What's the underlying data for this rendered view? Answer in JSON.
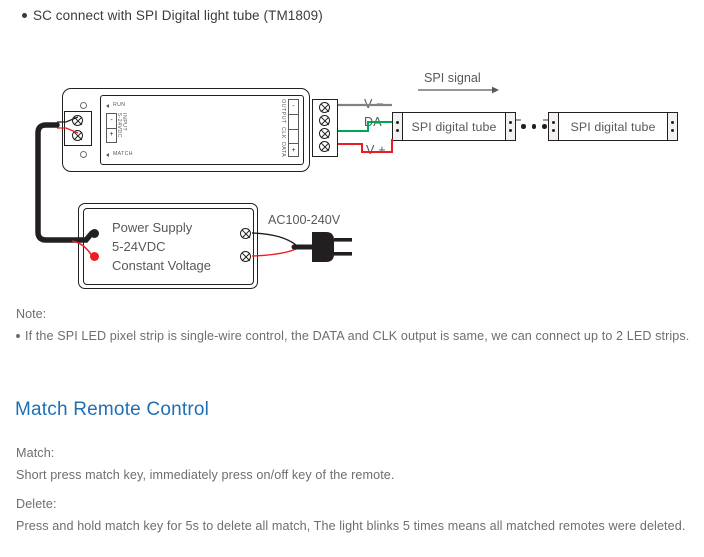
{
  "intro": {
    "bullet": "SC connect with SPI Digital light tube (TM1809)"
  },
  "diagram": {
    "signal_label": "SPI signal",
    "controller": {
      "run_label": "RUN",
      "match_label": "MATCH",
      "input_label": "INPUT",
      "input_voltage": "5-24VDC",
      "input_minus": "-",
      "input_plus": "+",
      "output_label": "OUTPUT",
      "clk_label": "CLK",
      "data_label": "DATA",
      "output_minus": "-",
      "output_plus": "+"
    },
    "wires": {
      "v_minus": "V −",
      "data": "DA",
      "v_plus": "V +"
    },
    "tubes": [
      {
        "label": "SPI digital tube"
      },
      {
        "label": "SPI digital tube"
      }
    ],
    "ellipsis": "•••",
    "power_supply": {
      "line1": "Power Supply",
      "line2": "5-24VDC",
      "line3": "Constant Voltage"
    },
    "ac_label": "AC100-240V",
    "colors": {
      "wire_neutral": "#808285",
      "wire_data": "#00a651",
      "wire_positive": "#ed1c24",
      "outline": "#231f20"
    }
  },
  "note": {
    "title": "Note:",
    "items": [
      "If the SPI LED pixel strip is single-wire control, the DATA and CLK output is same, we can connect up to 2 LED strips."
    ]
  },
  "match_section": {
    "heading": "Match Remote Control",
    "heading_color": "#1f6fb5",
    "blocks": [
      {
        "label": "Match:",
        "text": "Short press match key, immediately press on/off key of the remote."
      },
      {
        "label": "Delete:",
        "text": "Press and hold match key for 5s to delete all match, The light blinks 5 times means all matched remotes were deleted."
      }
    ]
  }
}
